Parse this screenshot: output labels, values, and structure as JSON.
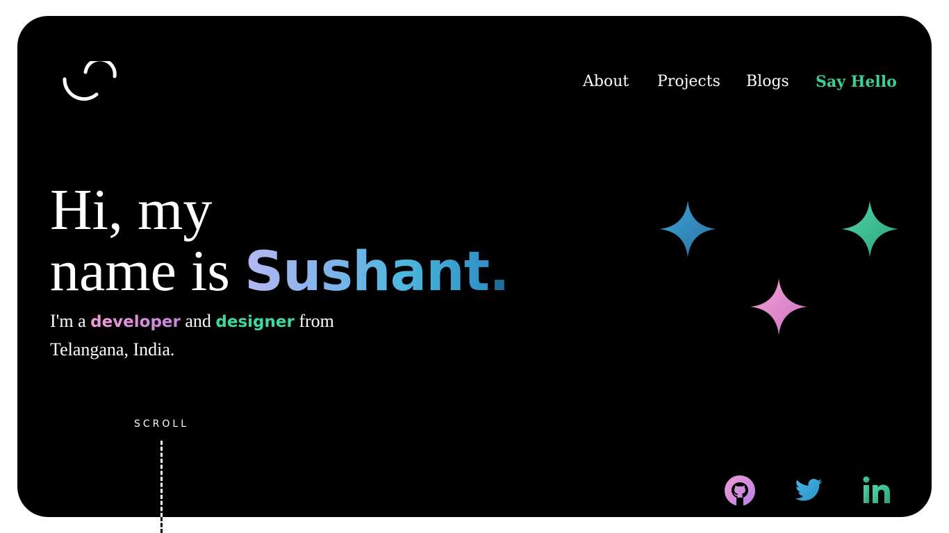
{
  "nav": {
    "items": [
      {
        "label": "About"
      },
      {
        "label": "Projects"
      },
      {
        "label": "Blogs"
      },
      {
        "label": "Say Hello"
      }
    ]
  },
  "hero": {
    "line1": "Hi, my",
    "line2_prefix": "name is ",
    "name": "Sushant",
    "name_dot": ".",
    "intro": {
      "part1": "I'm a ",
      "developer": "developer",
      "part2": " and ",
      "designer": "designer",
      "part3": " from",
      "line2": "Telangana, India."
    }
  },
  "scroll_label": "SCROLL",
  "icons": {
    "logo": "smile-logo-icon",
    "sparkles": [
      "sparkle-blue-icon",
      "sparkle-green-icon",
      "sparkle-pink-icon"
    ],
    "socials": [
      "github-icon",
      "twitter-icon",
      "linkedin-icon"
    ]
  },
  "colors": {
    "background": "#000000",
    "accent_green": "#3ecf95",
    "name_gradient_start": "#b7b8f2",
    "name_gradient_end": "#2f90c4",
    "developer_pink": "#f29ad3",
    "designer_green": "#3fd89c"
  }
}
